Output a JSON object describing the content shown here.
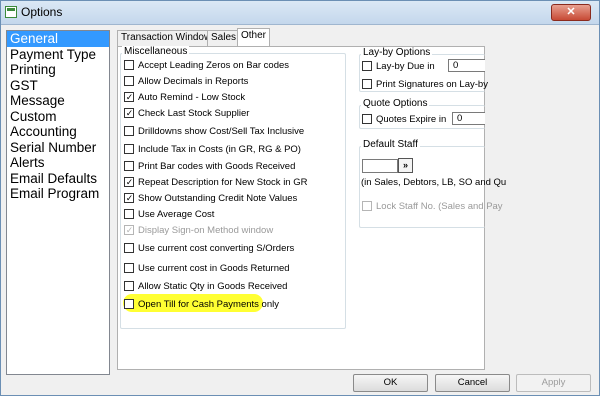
{
  "window": {
    "title": "Options",
    "close_label": "✕"
  },
  "nav": {
    "items": [
      {
        "label": "General",
        "selected": true
      },
      {
        "label": "Payment Type"
      },
      {
        "label": "Printing"
      },
      {
        "label": "GST"
      },
      {
        "label": "Message"
      },
      {
        "label": "Custom"
      },
      {
        "label": "Accounting"
      },
      {
        "label": "Serial Number"
      },
      {
        "label": "Alerts"
      },
      {
        "label": "Email Defaults"
      },
      {
        "label": "Email Program"
      }
    ]
  },
  "tabs": [
    "Transaction Windows",
    "Sales",
    "Other"
  ],
  "miscellaneous": {
    "title": "Miscellaneous",
    "options": [
      {
        "label": "Accept Leading Zeros on Bar codes",
        "checked": false
      },
      {
        "label": "Allow Decimals in Reports",
        "checked": false
      },
      {
        "label": "Auto Remind - Low Stock",
        "checked": true
      },
      {
        "label": "Check Last Stock Supplier",
        "checked": true
      },
      {
        "label": "Drilldowns show Cost/Sell Tax Inclusive",
        "checked": false
      },
      {
        "label": "Include Tax in Costs (in GR, RG & PO)",
        "checked": false
      },
      {
        "label": "Print Bar codes with Goods Received",
        "checked": false
      },
      {
        "label": "Repeat Description for New Stock in GR",
        "checked": true
      },
      {
        "label": "Show Outstanding Credit Note Values",
        "checked": true
      },
      {
        "label": "Use Average Cost",
        "checked": false
      },
      {
        "label": "Display Sign-on Method window",
        "checked": true,
        "disabled": true
      },
      {
        "label": "Use current cost converting S/Orders",
        "checked": false
      },
      {
        "label": "Use current cost in Goods Returned",
        "checked": false
      },
      {
        "label": "Allow Static Qty in Goods Received",
        "checked": false
      },
      {
        "label": "Open Till for Cash Payments only",
        "checked": false
      }
    ]
  },
  "layby": {
    "title": "Lay-by Options",
    "due_label": "Lay-by Due in",
    "due_value": "0",
    "print_label": "Print Signatures on Lay-by"
  },
  "quote": {
    "title": "Quote Options",
    "expire_label": "Quotes Expire in",
    "expire_value": "0"
  },
  "staff": {
    "title": "Default Staff",
    "button_label": "»",
    "note": "(in Sales, Debtors, LB, SO and Qu",
    "lock_label": "Lock Staff No. (Sales and Pay"
  },
  "buttons": {
    "ok": "OK",
    "cancel": "Cancel",
    "apply": "Apply"
  },
  "colors": {
    "highlight": "#ffff33",
    "selection": "#3399ff"
  }
}
